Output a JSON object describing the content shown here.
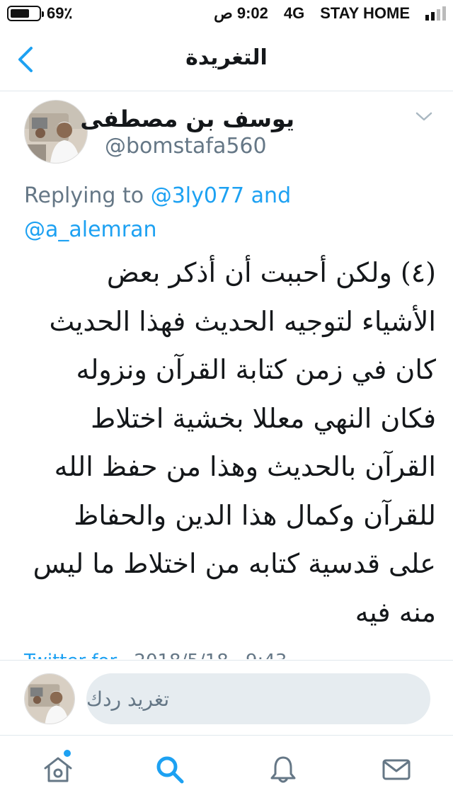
{
  "status_bar": {
    "battery": "69٪",
    "time": "9:02 ص",
    "network": "4G",
    "carrier": "STAY HOME",
    "battery_level": 0.69
  },
  "nav": {
    "title": "التغريدة",
    "back_icon": "chevron-left-icon"
  },
  "tweet": {
    "author_name": "يوسف بن مصطفى",
    "author_handle": "@bomstafa560",
    "replying_prefix": "Replying to",
    "replying_to": [
      "@3ly077",
      "@a_alemran"
    ],
    "replying_join": "and",
    "body": "(٤) ولكن أحببت أن أذكر بعض الأشياء لتوجيه الحديث فهذا الحديث كان في زمن كتابة القرآن ونزوله فكان النهي معللا بخشية اختلاط القرآن بالحديث وهذا من حفظ الله للقرآن وكمال هذا الدين والحفاظ على قدسية كتابه من اختلاط ما ليس منه فيه",
    "source": "Twitter for",
    "date": "2018/5/18",
    "time": "9:43"
  },
  "reply_bar": {
    "placeholder": "تغريد ردك"
  },
  "tab_bar": {
    "items": [
      "home-icon",
      "search-icon",
      "bell-icon",
      "mail-icon"
    ],
    "active": "search-icon"
  },
  "colors": {
    "accent": "#1da1f2",
    "muted": "#657786",
    "input_bg": "#e6ecf0",
    "divider": "#e1e8ed"
  }
}
